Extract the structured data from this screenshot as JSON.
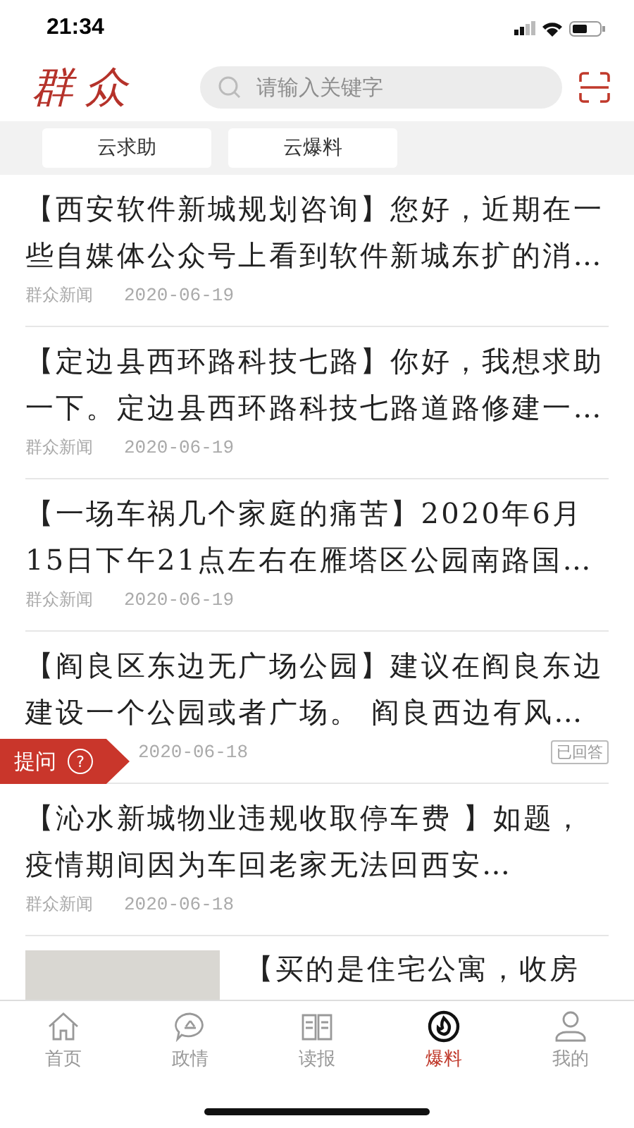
{
  "status_bar": {
    "time": "21:34"
  },
  "header": {
    "logo": "群众",
    "search": {
      "placeholder": "请输入关键字"
    }
  },
  "tabs": [
    {
      "label": "云求助",
      "selected": false
    },
    {
      "label": "云爆料",
      "selected": false
    }
  ],
  "articles": [
    {
      "kind": "text",
      "title": "【西安软件新城规划咨询】您好，近期在一些自媒体公众号上看到软件新城东扩的消…",
      "source": "群众新闻",
      "date": "2020-06-19"
    },
    {
      "kind": "text",
      "title": "【定边县西环路科技七路】你好，我想求助一下。定边县西环路科技七路道路修建一…",
      "source": "群众新闻",
      "date": "2020-06-19"
    },
    {
      "kind": "text",
      "title": "【一场车祸几个家庭的痛苦】2020年6月15日下午21点左右在雁塔区公园南路国…",
      "source": "群众新闻",
      "date": "2020-06-19"
    },
    {
      "kind": "text",
      "title": "【阎良区东边无广场公园】建议在阎良东边建设一个公园或者广场。 阎良西边有风…",
      "date": "2020-06-18",
      "badge": "已回答"
    },
    {
      "kind": "text",
      "title": "【沁水新城物业违规收取停车费 】如题，疫情期间因为车回老家无法回西安…",
      "source": "群众新闻",
      "date": "2020-06-18"
    },
    {
      "kind": "image",
      "title": "【买的是住宅公寓，收房"
    }
  ],
  "ask_button": {
    "label": "提问",
    "icon": "?"
  },
  "bottom_nav": [
    {
      "label": "首页",
      "selected": false
    },
    {
      "label": "政情",
      "selected": false
    },
    {
      "label": "读报",
      "selected": false
    },
    {
      "label": "爆料",
      "selected": true
    },
    {
      "label": "我的",
      "selected": false
    }
  ]
}
